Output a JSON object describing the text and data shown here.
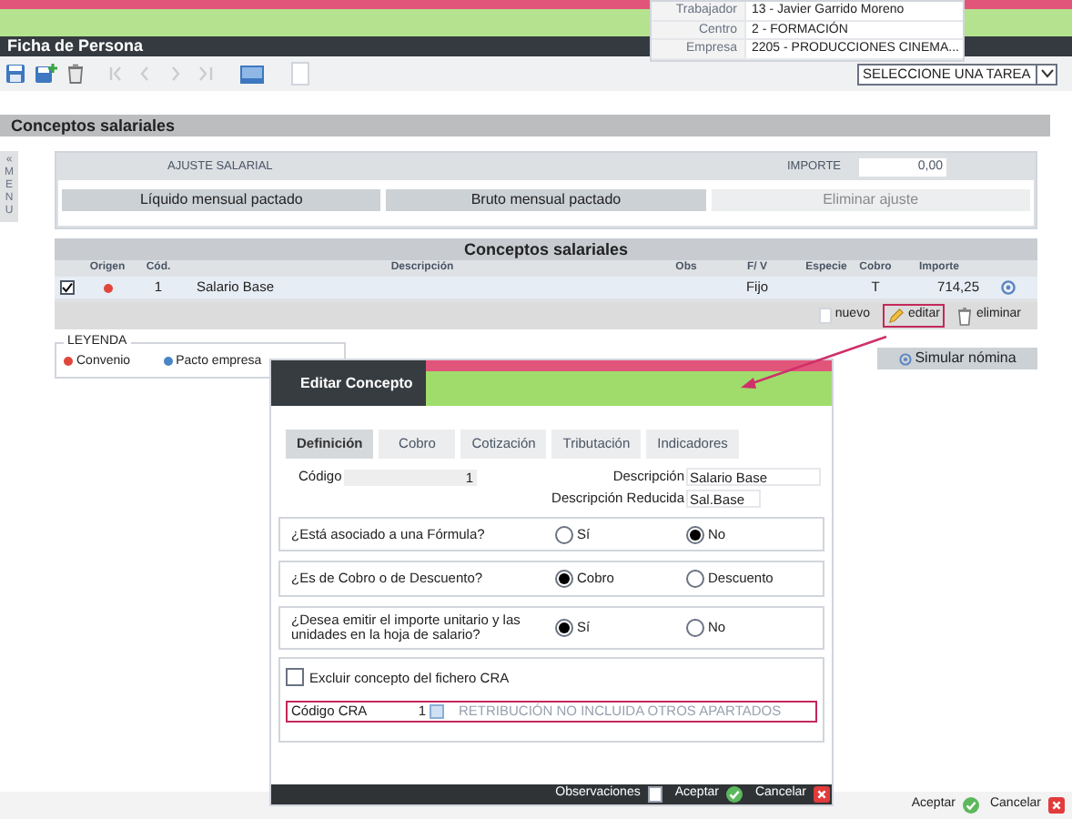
{
  "header": {
    "title": "Ficha de Persona",
    "info": [
      {
        "label": "Trabajador",
        "value": "13 - Javier Garrido Moreno"
      },
      {
        "label": "Centro",
        "value": "2 - FORMACIÓN"
      },
      {
        "label": "Empresa",
        "value": "2205 - PRODUCCIONES CINEMA..."
      }
    ]
  },
  "toolbar": {
    "task_select": {
      "value": "SELECCIONE UNA TAREA"
    }
  },
  "section_title": "Conceptos salariales",
  "menu_tab": {
    "label": "« MENU"
  },
  "ajuste": {
    "label": "AJUSTE SALARIAL",
    "importe_label": "IMPORTE",
    "importe_value": "0,00",
    "buttons": [
      {
        "label": "Líquido mensual pactado",
        "disabled": false
      },
      {
        "label": "Bruto mensual pactado",
        "disabled": false
      },
      {
        "label": "Eliminar ajuste",
        "disabled": true
      }
    ]
  },
  "conceptos": {
    "title": "Conceptos salariales",
    "columns": [
      "",
      "Origen",
      "Cód.",
      "Descripción",
      "Obs",
      "F/ V",
      "Especie",
      "Cobro",
      "Importe"
    ],
    "rows": [
      {
        "checked": true,
        "color": "#e0463a",
        "cod": "1",
        "descripcion": "Salario Base",
        "fv": "Fijo",
        "cobro": "T",
        "importe": "714,25"
      }
    ],
    "actions": [
      {
        "kind": "new",
        "label": "nuevo",
        "highlighted": false
      },
      {
        "kind": "edit",
        "label": "editar",
        "highlighted": true
      },
      {
        "kind": "delete",
        "label": "eliminar",
        "highlighted": false
      }
    ]
  },
  "leyenda": {
    "title": "LEYENDA",
    "items": [
      {
        "label": "Convenio",
        "color": "#e0463a"
      },
      {
        "label": "Pacto empresa",
        "color": "#4a86c5"
      }
    ]
  },
  "simular_button": {
    "label": "Simular nómina"
  },
  "dialog": {
    "title": "Editar Concepto",
    "tabs": [
      {
        "label": "Definición",
        "selected": true
      },
      {
        "label": "Cobro",
        "selected": false
      },
      {
        "label": "Cotización",
        "selected": false
      },
      {
        "label": "Tributación",
        "selected": false
      },
      {
        "label": "Indicadores",
        "selected": false
      }
    ],
    "codigo": {
      "label": "Código",
      "value": "1"
    },
    "descripcion": {
      "label": "Descripción",
      "value": "Salario Base"
    },
    "descripcion_reducida": {
      "label": "Descripción Reducida",
      "value": "Sal.Base"
    },
    "questions": [
      {
        "label": "¿Está asociado a una Fórmula?",
        "options": [
          {
            "label": "Sí",
            "selected": false
          },
          {
            "label": "No",
            "selected": true
          }
        ]
      },
      {
        "label": "¿Es de Cobro o de Descuento?",
        "options": [
          {
            "label": "Cobro",
            "selected": true
          },
          {
            "label": "Descuento",
            "selected": false
          }
        ]
      },
      {
        "label": "¿Desea emitir el importe unitario y las unidades en la hoja de salario?",
        "options": [
          {
            "label": "Sí",
            "selected": true
          },
          {
            "label": "No",
            "selected": false
          }
        ]
      }
    ],
    "excluir": {
      "label": "Excluir concepto del fichero CRA",
      "checked": false
    },
    "codigo_cra": {
      "label": "Código CRA",
      "value": "1",
      "description": "RETRIBUCIÓN NO INCLUIDA OTROS APARTADOS"
    },
    "footer": [
      {
        "kind": "notes",
        "label": "Observaciones"
      },
      {
        "kind": "accept",
        "label": "Aceptar"
      },
      {
        "kind": "cancel",
        "label": "Cancelar"
      }
    ]
  },
  "page_footer": [
    {
      "kind": "accept",
      "label": "Aceptar"
    },
    {
      "kind": "cancel",
      "label": "Cancelar"
    }
  ]
}
